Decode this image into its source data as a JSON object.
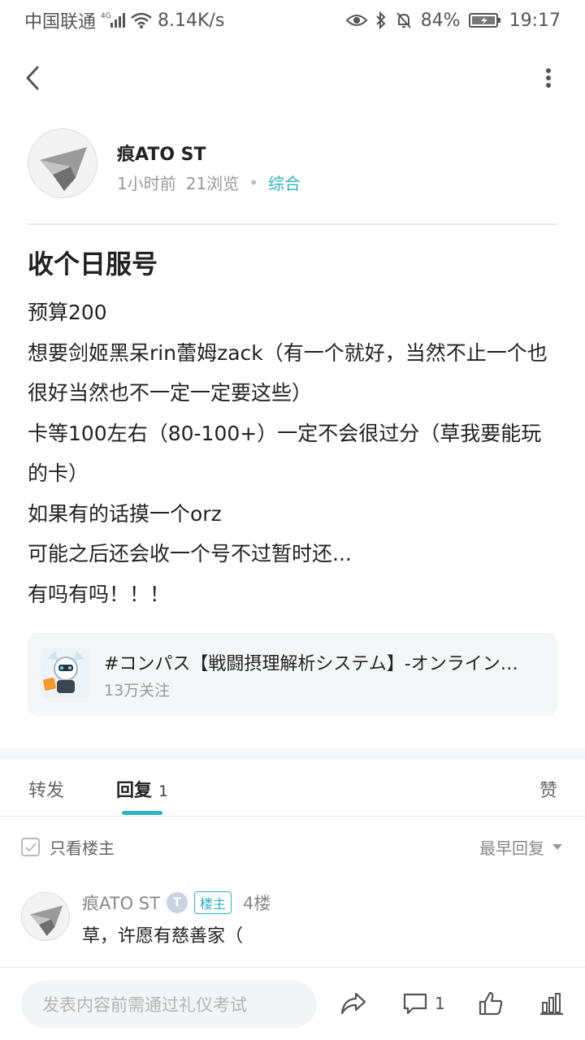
{
  "status_bar": {
    "carrier": "中国联通",
    "network": "4G",
    "speed": "8.14K/s",
    "battery": "84%",
    "time": "19:17"
  },
  "post": {
    "author_name": "痕ATO ST",
    "time_ago": "1小时前",
    "views": "21浏览",
    "category": "综合",
    "title": "收个日服号",
    "body": [
      "预算200",
      "想要剑姬黑呆rin蕾姆zack（有一个就好，当然不止一个也很好当然也不一定一定要这些）",
      "卡等100左右（80-100+）一定不会很过分（草我要能玩的卡）",
      "如果有的话摸一个orz",
      "可能之后还会收一个号不过暂时还...",
      "有吗有吗！！！"
    ]
  },
  "topic": {
    "title": "#コンパス【戦闘摂理解析システム】-オンライン対戦",
    "followers": "13万关注"
  },
  "tabs": {
    "forward": "转发",
    "reply": "回复",
    "reply_count": "1",
    "like": "赞"
  },
  "filter": {
    "only_op": "只看楼主",
    "sort": "最早回复"
  },
  "reply": {
    "author": "痕ATO ST",
    "level": "T",
    "op_badge": "楼主",
    "floor": "4楼",
    "text": "草，许愿有慈善家（"
  },
  "bottom_bar": {
    "input_placeholder": "发表内容前需通过礼仪考试",
    "comment_count": "1"
  },
  "colors": {
    "accent": "#2bb3c0",
    "text": "#222222",
    "muted": "#999999"
  }
}
